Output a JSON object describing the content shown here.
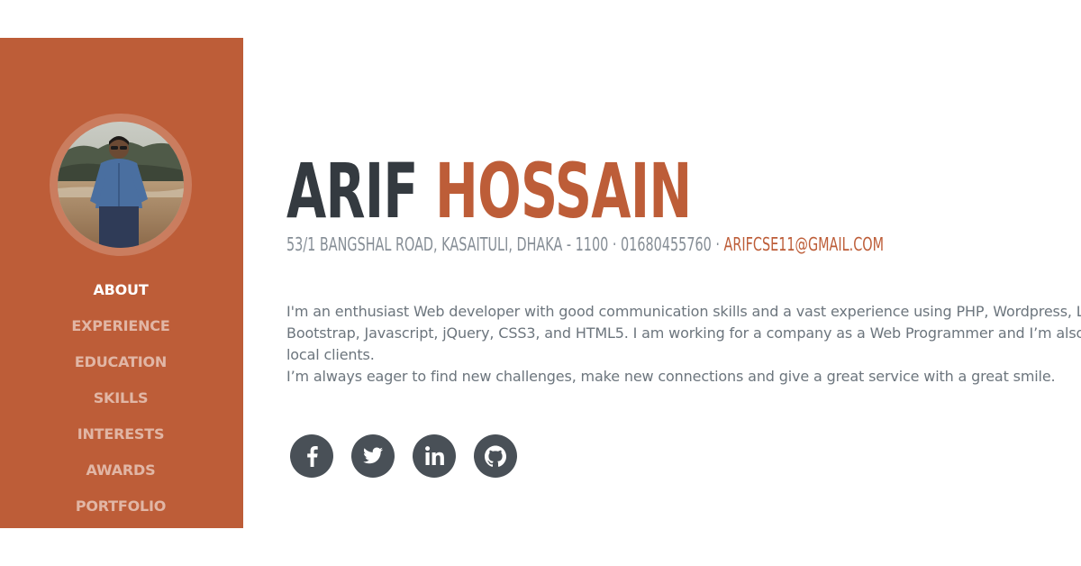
{
  "sidebar": {
    "avatar_alt": "profile photo",
    "nav": [
      {
        "label": "About",
        "active": true
      },
      {
        "label": "Experience"
      },
      {
        "label": "Education"
      },
      {
        "label": "Skills"
      },
      {
        "label": "Interests"
      },
      {
        "label": "Awards"
      },
      {
        "label": "Portfolio"
      }
    ]
  },
  "profile": {
    "first_name": "Arif",
    "last_name": "Hossain",
    "address": "53/1 Bangshal Road, Kasaituli, Dhaka - 1100",
    "separator": "·",
    "phone": "01680455760",
    "email": "arifcse11@gmail.com",
    "bio_lines": [
      "I'm an enthusiast Web developer with good communication skills and a vast experience using PHP, Wordpress, Laravel,",
      "Bootstrap, Javascript, jQuery, CSS3, and HTML5. I am working for a company as a Web Programmer and I’m also a freel",
      "local clients.",
      "I’m always eager to find new challenges, make new connections and give a great service with a great smile."
    ]
  },
  "social": [
    {
      "icon": "facebook-icon"
    },
    {
      "icon": "twitter-icon"
    },
    {
      "icon": "linkedin-icon"
    },
    {
      "icon": "github-icon"
    }
  ],
  "colors": {
    "primary": "#bd5d38",
    "dark": "#343a40",
    "muted": "#868e96",
    "social_bg": "#495057"
  }
}
